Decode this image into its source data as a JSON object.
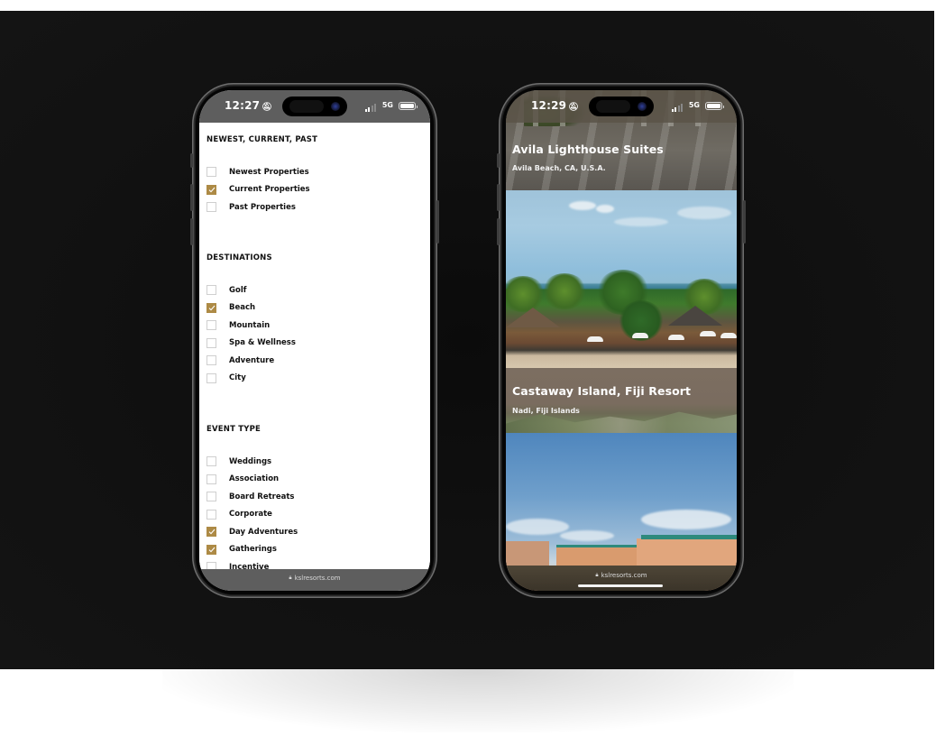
{
  "left_phone": {
    "status": {
      "time": "12:27",
      "network": "5G",
      "silent_icon": "bell-slash-icon"
    },
    "filter_groups": [
      {
        "heading": "NEWEST, CURRENT, PAST",
        "items": [
          {
            "label": "Newest Properties",
            "checked": false
          },
          {
            "label": "Current Properties",
            "checked": true
          },
          {
            "label": "Past Properties",
            "checked": false
          }
        ]
      },
      {
        "heading": "DESTINATIONS",
        "items": [
          {
            "label": "Golf",
            "checked": false
          },
          {
            "label": "Beach",
            "checked": true
          },
          {
            "label": "Mountain",
            "checked": false
          },
          {
            "label": "Spa & Wellness",
            "checked": false
          },
          {
            "label": "Adventure",
            "checked": false
          },
          {
            "label": "City",
            "checked": false
          }
        ]
      },
      {
        "heading": "EVENT TYPE",
        "items": [
          {
            "label": "Weddings",
            "checked": false
          },
          {
            "label": "Association",
            "checked": false
          },
          {
            "label": "Board Retreats",
            "checked": false
          },
          {
            "label": "Corporate",
            "checked": false
          },
          {
            "label": "Day Adventures",
            "checked": true
          },
          {
            "label": "Gatherings",
            "checked": true
          },
          {
            "label": "Incentive",
            "checked": false
          }
        ]
      }
    ],
    "url": "kslresorts.com"
  },
  "right_phone": {
    "status": {
      "time": "12:29",
      "network": "5G",
      "silent_icon": "bell-slash-icon"
    },
    "properties": [
      {
        "name": "Avila Lighthouse Suites",
        "location": "Avila Beach, CA, U.S.A."
      },
      {
        "name": "Castaway Island, Fiji Resort",
        "location": "Nadi, Fiji Islands"
      }
    ],
    "url": "kslresorts.com"
  },
  "colors": {
    "checkbox_checked": "#ad8a45",
    "stage_background": "#121212",
    "browser_chrome_left": "#5e5e5e"
  }
}
